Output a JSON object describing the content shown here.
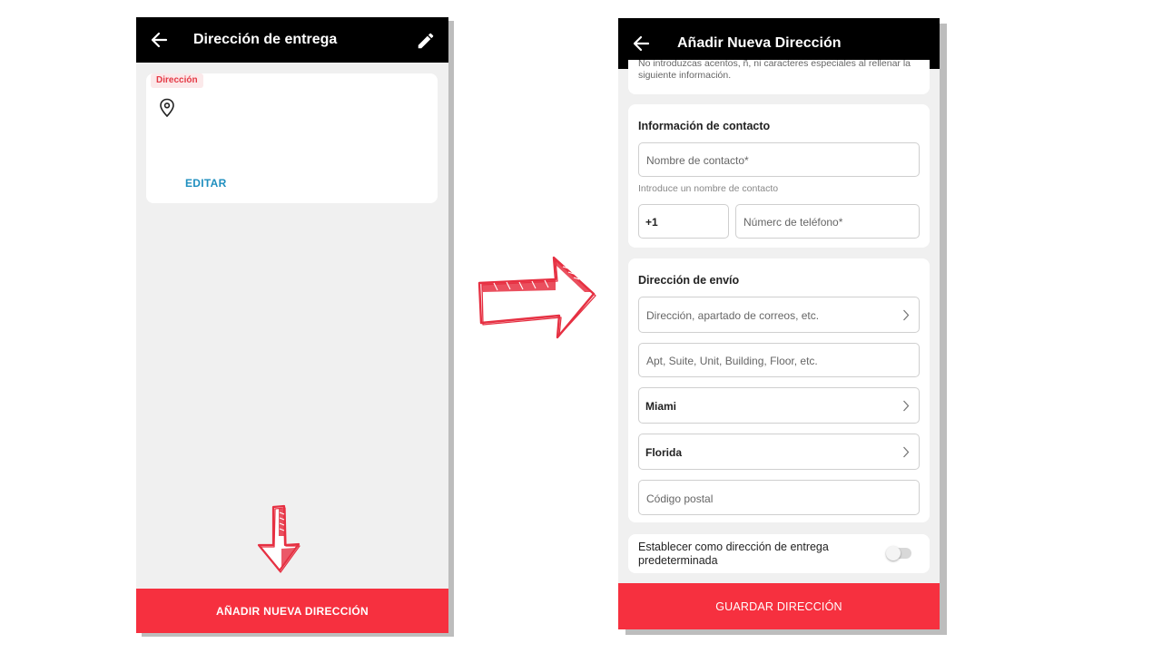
{
  "left_screen": {
    "title": "Dirección de entrega",
    "address_card": {
      "tag": "Dirección",
      "edit_label": "EDITAR"
    },
    "add_button_label": "AÑADIR NUEVA DIRECCIÓN"
  },
  "right_screen": {
    "title": "Añadir Nueva Dirección",
    "notice": "No introduzcas acentos, ñ, ni caracteres especiales al rellenar la siguiente información.",
    "contact": {
      "title": "Información de contacto",
      "name_placeholder": "Nombre de contacto*",
      "name_hint": "Introduce un nombre de contacto",
      "phone_code": "+1",
      "phone_placeholder": "Númerc de teléfono*"
    },
    "shipping": {
      "title": "Dirección de envío",
      "address_placeholder": "Dirección, apartado de correos, etc.",
      "apt_placeholder": "Apt, Suite, Unit, Building, Floor, etc.",
      "city": "Miami",
      "state": "Florida",
      "zip_placeholder": "Código postal"
    },
    "default_label": "Establecer como dirección de entrega predeterminada",
    "default_enabled": false,
    "save_button_label": "GUARDAR DIRECCIÓN"
  },
  "colors": {
    "header": "#000000",
    "accent": "#f6303f",
    "link": "#1f8fbf",
    "background": "#f0f0f0"
  },
  "icons": [
    "back-arrow-icon",
    "pencil-icon",
    "location-pin-icon",
    "chevron-right-icon",
    "toggle-switch"
  ]
}
